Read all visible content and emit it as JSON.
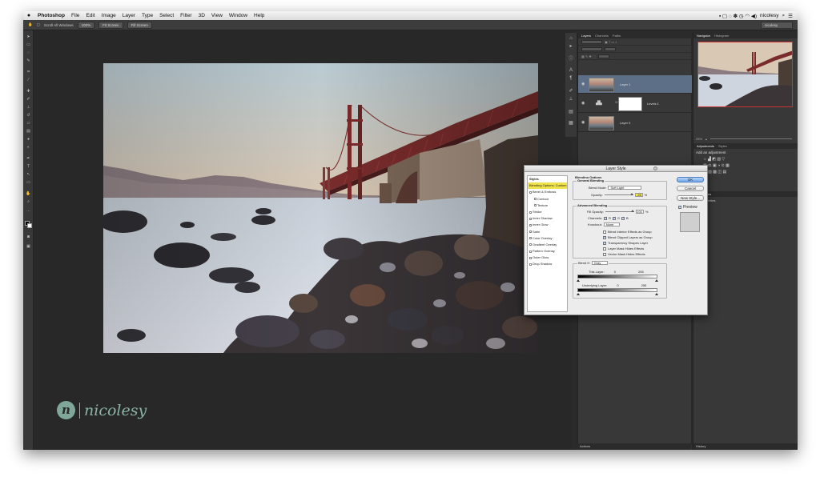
{
  "menubar": {
    "apple": "",
    "items": [
      "Photoshop",
      "File",
      "Edit",
      "Image",
      "Layer",
      "Type",
      "Select",
      "Filter",
      "3D",
      "View",
      "Window",
      "Help"
    ],
    "user": "nicolesy",
    "search_icon": "search-icon",
    "list_icon": "list-icon"
  },
  "optionsbar": {
    "scroll_all": "Scroll All Windows",
    "btn_100": "100%",
    "btn_fit": "Fit Screen",
    "btn_fill": "Fill Screen",
    "workspace": "nicolesy"
  },
  "layers_panel": {
    "tabs": [
      "Layers",
      "Channels",
      "Paths"
    ],
    "layers": [
      {
        "name": "Layer 1",
        "selected": true
      },
      {
        "name": "Levels 1",
        "selected": false
      },
      {
        "name": "Layer 0",
        "selected": false
      }
    ]
  },
  "right_panels": {
    "nav_tabs": [
      "Navigator",
      "Histogram"
    ],
    "zoom": "25%",
    "adj_tabs": [
      "Adjustments",
      "Styles"
    ],
    "adj_title": "Add an adjustment",
    "properties_tab": "Properties",
    "properties_body": "No Properties",
    "history_tab": "History"
  },
  "actions_tab": "Actions",
  "logo": {
    "mark": "n",
    "name": "nicolesy"
  },
  "dialog": {
    "title": "Layer Style",
    "styles": [
      {
        "label": "Styles",
        "type": "head"
      },
      {
        "label": "Blending Options: Custom",
        "type": "active"
      },
      {
        "label": "Bevel & Emboss",
        "type": "cb"
      },
      {
        "label": "Contour",
        "type": "indent"
      },
      {
        "label": "Texture",
        "type": "indent"
      },
      {
        "label": "Stroke",
        "type": "cb"
      },
      {
        "label": "Inner Shadow",
        "type": "cb"
      },
      {
        "label": "Inner Glow",
        "type": "cb"
      },
      {
        "label": "Satin",
        "type": "cb"
      },
      {
        "label": "Color Overlay",
        "type": "cb"
      },
      {
        "label": "Gradient Overlay",
        "type": "cb"
      },
      {
        "label": "Pattern Overlay",
        "type": "cb"
      },
      {
        "label": "Outer Glow",
        "type": "cb"
      },
      {
        "label": "Drop Shadow",
        "type": "cb"
      }
    ],
    "blending_options": "Blending Options",
    "general_blending": "General Blending",
    "blend_mode_label": "Blend Mode:",
    "blend_mode_value": "Soft Light",
    "opacity_label": "Opacity:",
    "opacity_value": "25",
    "percent": "%",
    "advanced_blending": "Advanced Blending",
    "fill_opacity_label": "Fill Opacity:",
    "fill_opacity_value": "100",
    "channels_label": "Channels:",
    "channels": [
      "R",
      "G",
      "B"
    ],
    "knockout_label": "Knockout:",
    "knockout_value": "None",
    "options": [
      {
        "label": "Blend Interior Effects as Group",
        "checked": false
      },
      {
        "label": "Blend Clipped Layers as Group",
        "checked": true
      },
      {
        "label": "Transparency Shapes Layer",
        "checked": true
      },
      {
        "label": "Layer Mask Hides Effects",
        "checked": false
      },
      {
        "label": "Vector Mask Hides Effects",
        "checked": false
      }
    ],
    "blend_if_label": "Blend If:",
    "blend_if_value": "Gray",
    "this_layer_label": "This Layer:",
    "this_layer_min": "0",
    "this_layer_max": "255",
    "underlying_label": "Underlying Layer:",
    "underlying_min": "0",
    "underlying_max": "255",
    "ok": "OK",
    "cancel": "Cancel",
    "new_style": "New Style...",
    "preview": "Preview"
  },
  "colors": {
    "accent_selected": "#5d6f86",
    "highlight_yellow": "#f0e24a",
    "logo_teal": "#7fa89a"
  }
}
